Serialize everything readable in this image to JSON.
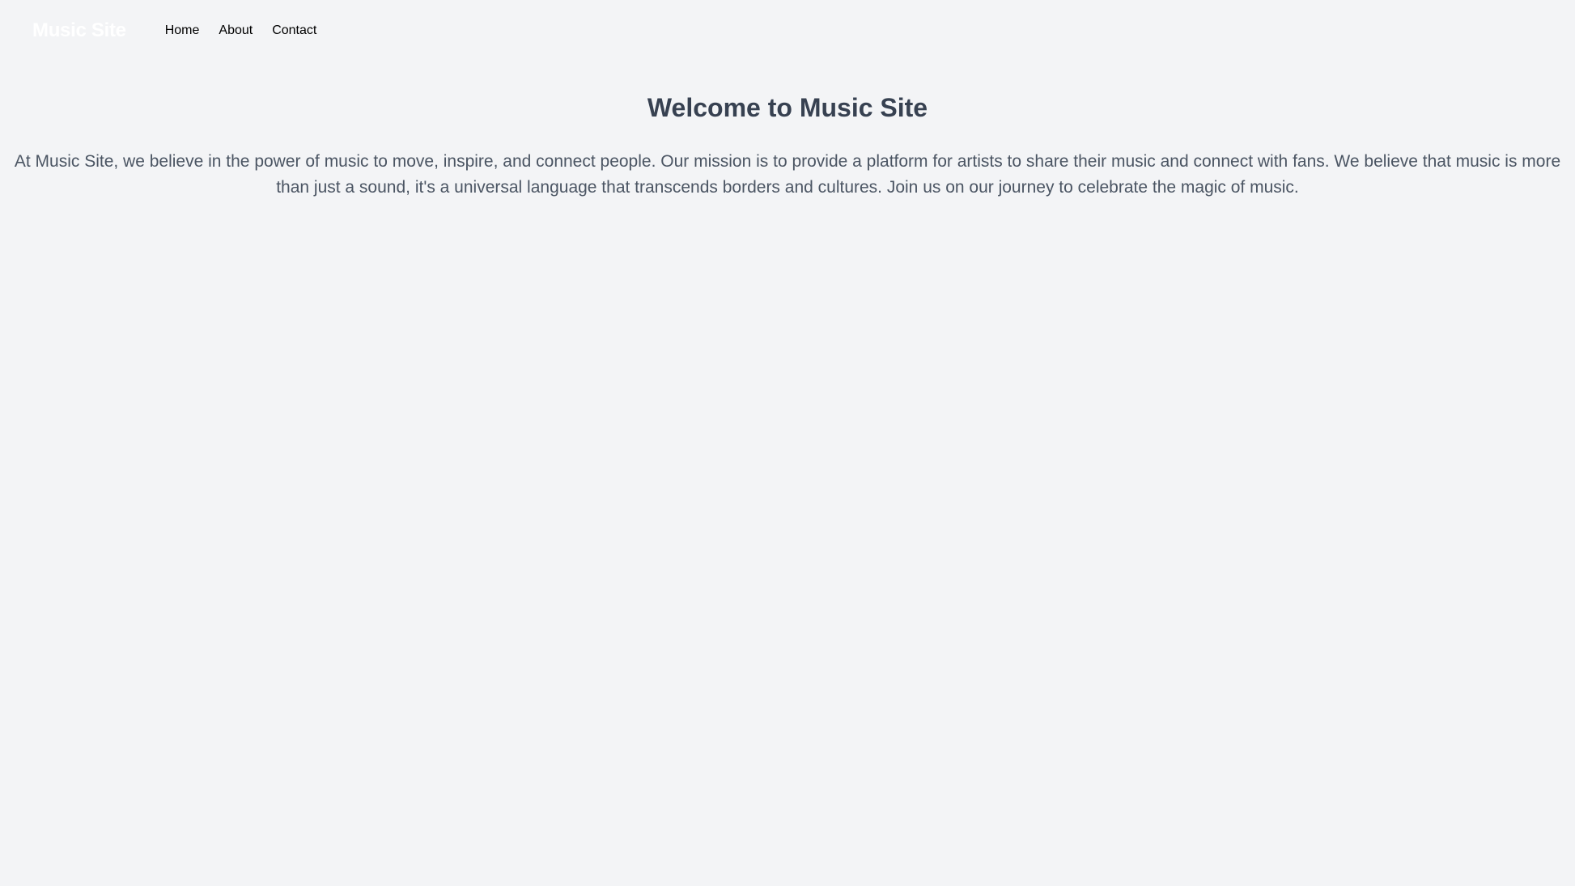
{
  "navbar": {
    "brand": {
      "title": "Music Site",
      "color": "#ffffff"
    },
    "links": [
      {
        "label": "Home"
      },
      {
        "label": "About"
      },
      {
        "label": "Contact"
      }
    ]
  },
  "main": {
    "heading": "Welcome to Music Site",
    "paragraph": "At Music Site, we believe in the power of music to move, inspire, and connect people. Our mission is to provide a platform for artists to share their music and connect with fans. We believe that music is more than just a sound, it's a universal language that transcends borders and cultures. Join us on our journey to celebrate the magic of music."
  },
  "theme": {
    "background": "#f3f4f6",
    "heading_color": "#374151",
    "body_text_color": "#4b5563",
    "nav_link_color": "#000000"
  }
}
